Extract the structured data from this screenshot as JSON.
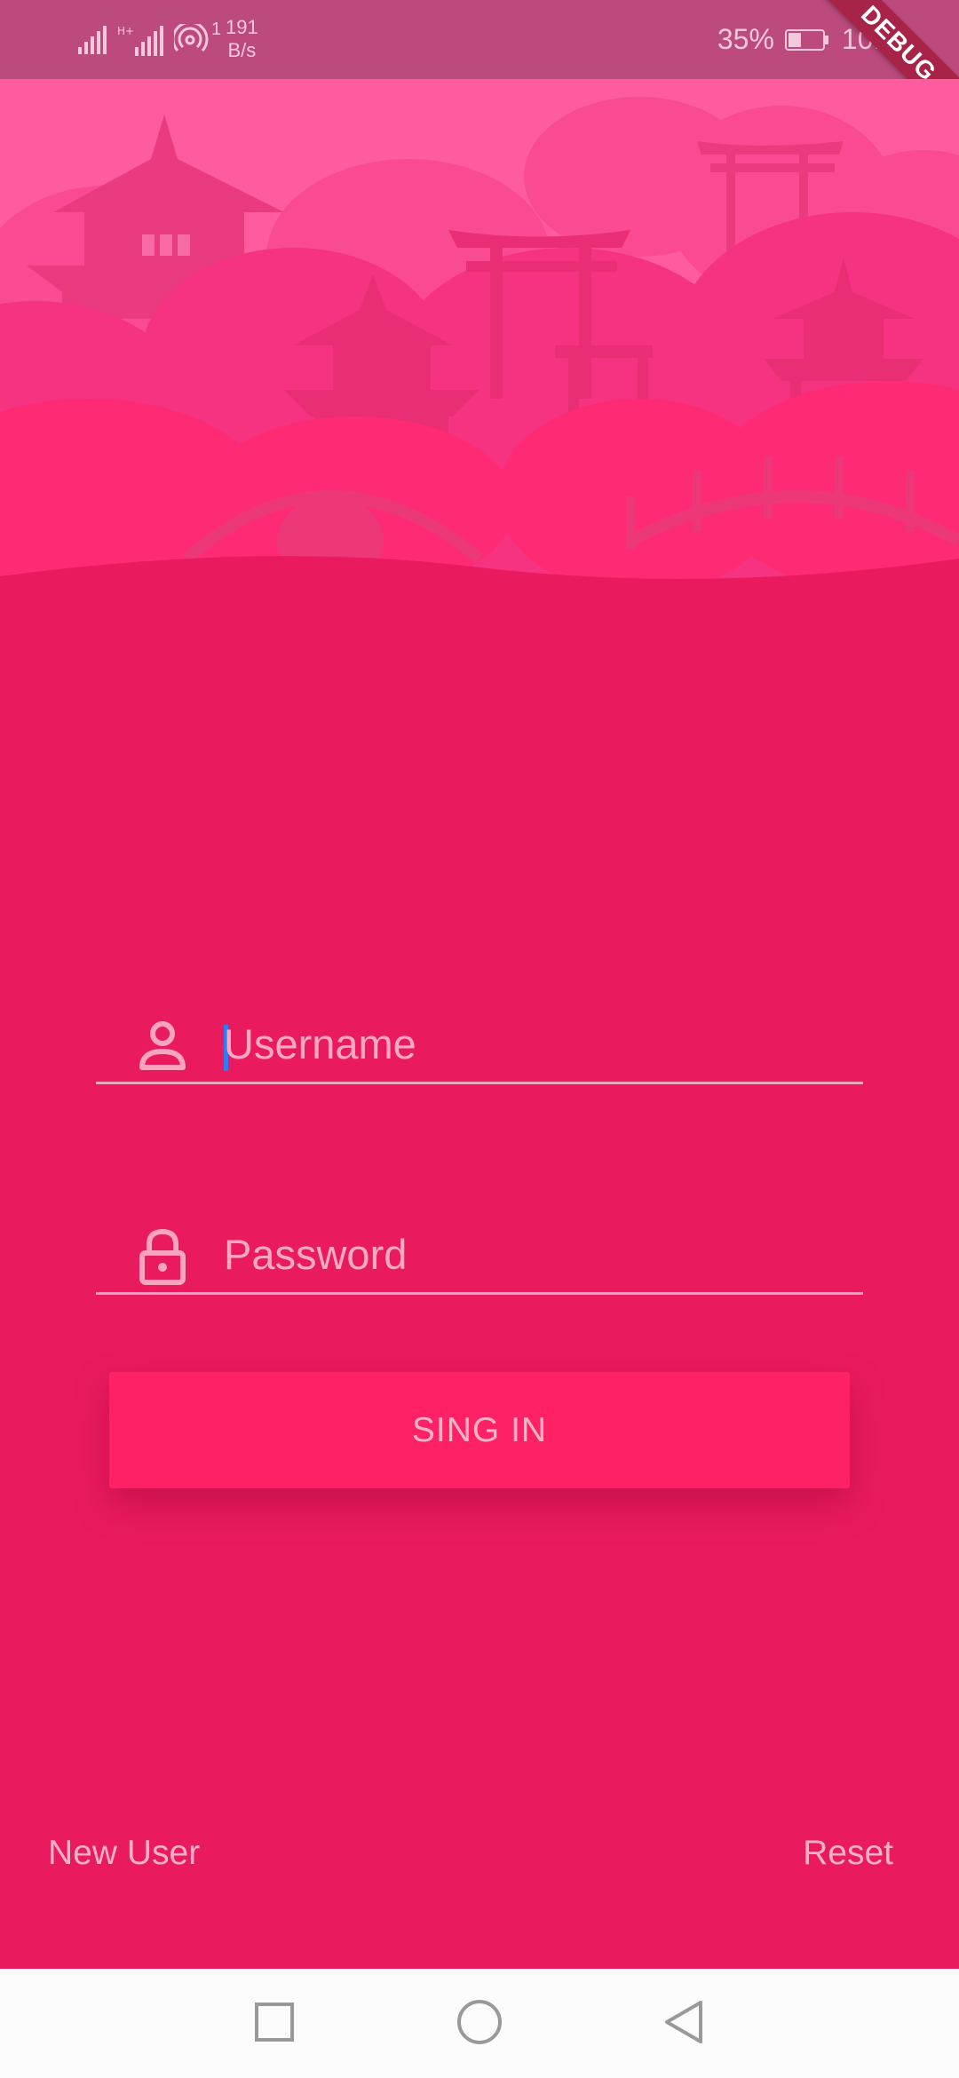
{
  "status_bar": {
    "sim_superscript": "1",
    "net_speed_value": "191",
    "net_speed_unit": "B/s",
    "battery_percent": "35%",
    "time": "10:06",
    "debug_banner": "DEBUG",
    "icons": [
      "signal-icon",
      "hplus-signal-icon",
      "hotspot-icon",
      "battery-icon"
    ]
  },
  "login": {
    "username_placeholder": "Username",
    "password_placeholder": "Password",
    "sign_in_label": "SING IN",
    "new_user_label": "New User",
    "reset_label": "Reset"
  },
  "nav_bar": {
    "icons": [
      "recents-square-icon",
      "home-circle-icon",
      "back-triangle-icon"
    ]
  },
  "colors": {
    "background": "#ea1a5f",
    "status_bar": "#bd4a7d",
    "button": "#ff2166",
    "text_accent": "#f7a9c4",
    "cursor": "#2f7df6"
  }
}
